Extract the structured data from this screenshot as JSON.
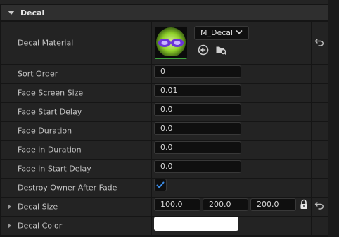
{
  "section": {
    "title": "Decal"
  },
  "properties": {
    "decal_material": {
      "label": "Decal Material",
      "value": "M_Decal"
    },
    "sort_order": {
      "label": "Sort Order",
      "value": "0"
    },
    "fade_screen_size": {
      "label": "Fade Screen Size",
      "value": "0.01"
    },
    "fade_start_delay": {
      "label": "Fade Start Delay",
      "value": "0.0"
    },
    "fade_duration": {
      "label": "Fade Duration",
      "value": "0.0"
    },
    "fade_in_duration": {
      "label": "Fade in Duration",
      "value": "0.0"
    },
    "fade_in_start_delay": {
      "label": "Fade in Start Delay",
      "value": "0.0"
    },
    "destroy_owner_after_fade": {
      "label": "Destroy Owner After Fade",
      "checked": true
    },
    "decal_size": {
      "label": "Decal Size",
      "x": "100.0",
      "y": "200.0",
      "z": "200.0"
    },
    "decal_color": {
      "label": "Decal Color",
      "color": "#ffffff"
    }
  },
  "icons": {
    "section_caret": "caret-down-icon",
    "material_thumbnail": "decal-material-thumbnail",
    "dropdown_chevron": "chevron-down-icon",
    "use_selected_asset": "arrow-left-circle-icon",
    "browse_asset": "folder-search-icon",
    "reset": "reset-arrow-icon",
    "lock": "lock-icon",
    "checkmark": "checkmark-icon",
    "expander": "caret-right-icon"
  },
  "colors": {
    "panel_bg": "#232323",
    "header_bg": "#2f2f2f",
    "field_bg": "#0f0f0f",
    "checkbox_accent": "#3c8ce6",
    "thumbnail_accent": "#3fa33f"
  }
}
